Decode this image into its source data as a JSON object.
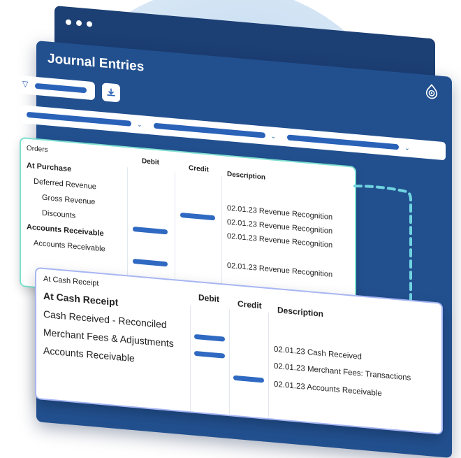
{
  "window": {
    "title": "Journal Entries"
  },
  "orders": {
    "section_label": "Orders",
    "columns": [
      "Debit",
      "Credit",
      "Description"
    ],
    "rows": [
      {
        "label": "At Purchase",
        "bold": true
      },
      {
        "label": "Deferred Revenue"
      },
      {
        "label": "Gross Revenue"
      },
      {
        "label": "Discounts"
      },
      {
        "label": "Accounts Receivable",
        "bold": true
      },
      {
        "label": "Accounts Receivable"
      }
    ],
    "descriptions": [
      "02.01.23 Revenue Recognition",
      "02.01.23 Revenue Recognition",
      "02.01.23 Revenue Recognition",
      "02.01.23 Revenue Recognition"
    ]
  },
  "cash": {
    "section_label": "At Cash Receipt",
    "columns": [
      "Debit",
      "Credit",
      "Description"
    ],
    "rows": [
      {
        "label": "At Cash Receipt",
        "bold": true
      },
      {
        "label": "Cash Received - Reconciled"
      },
      {
        "label": "Merchant Fees & Adjustments"
      },
      {
        "label": "Accounts Receivable"
      }
    ],
    "descriptions": [
      "02.01.23 Cash Received",
      "02.01.23 Merchant Fees: Transactions",
      "02.01.23 Accounts Receivable"
    ]
  },
  "colors": {
    "accent": "#2f69c2",
    "window": "#22508f",
    "window_back": "#1c3f74",
    "highlight_teal": "#7ee0d0",
    "highlight_violet": "#a7b6f4"
  },
  "icons": [
    "window-dots-icon",
    "brand-logo-icon",
    "filter-icon",
    "download-icon",
    "chevron-down-icon"
  ]
}
